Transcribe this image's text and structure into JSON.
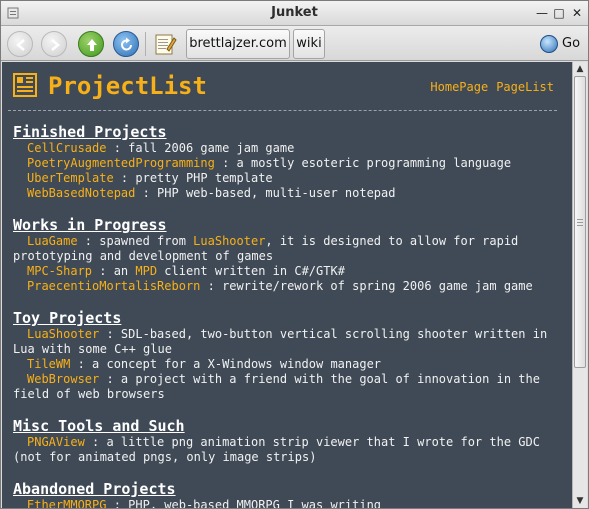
{
  "window": {
    "title": "Junket"
  },
  "toolbar": {
    "bookmark1": "brettlajzer.com",
    "bookmark2": "wiki",
    "go_label": "Go"
  },
  "page": {
    "title": "ProjectList",
    "links": [
      "HomePage",
      "PageList"
    ],
    "sections": [
      {
        "heading": "Finished Projects",
        "items": [
          {
            "name": "CellCrusade",
            "desc": " : fall 2006 game jam game"
          },
          {
            "name": "PoetryAugmentedProgramming",
            "desc": " : a mostly esoteric programming language"
          },
          {
            "name": "UberTemplate",
            "desc": " : pretty PHP template"
          },
          {
            "name": "WebBasedNotepad",
            "desc": " : PHP web-based, multi-user notepad"
          }
        ]
      },
      {
        "heading": "Works in Progress",
        "items": [
          {
            "name": "LuaGame",
            "desc": " : spawned from ",
            "link2": "LuaShooter",
            "desc2": ", it is designed to allow for rapid",
            "cont": "prototyping and development of games"
          },
          {
            "name": "MPC-Sharp",
            "desc": " : an ",
            "link2": "MPD",
            "desc2": " client written in C#/GTK#"
          },
          {
            "name": "PraecentioMortalisReborn",
            "desc": " : rewrite/rework of spring 2006 game jam game"
          }
        ]
      },
      {
        "heading": "Toy Projects",
        "items": [
          {
            "name": "LuaShooter",
            "desc": " : SDL-based, two-button vertical scrolling shooter written in",
            "cont": "Lua with some C++ glue"
          },
          {
            "name": "TileWM",
            "desc": " : a concept for a X-Windows window manager"
          },
          {
            "name": "WebBrowser",
            "desc": " : a project with a friend with the goal of innovation in the",
            "cont": "field of web browsers"
          }
        ]
      },
      {
        "heading": "Misc Tools and Such",
        "items": [
          {
            "name": "PNGAView",
            "desc": " : a little png animation strip viewer that I wrote for the GDC",
            "cont": "(not for animated pngs, only image strips)"
          }
        ]
      },
      {
        "heading": "Abandoned Projects",
        "items": [
          {
            "name": "EtherMMORPG",
            "desc": " : PHP, web-based MMORPG I was writing"
          }
        ]
      }
    ]
  },
  "colors": {
    "background": "#3f4a56",
    "link": "#f8b018",
    "text": "#f1f1f1"
  }
}
